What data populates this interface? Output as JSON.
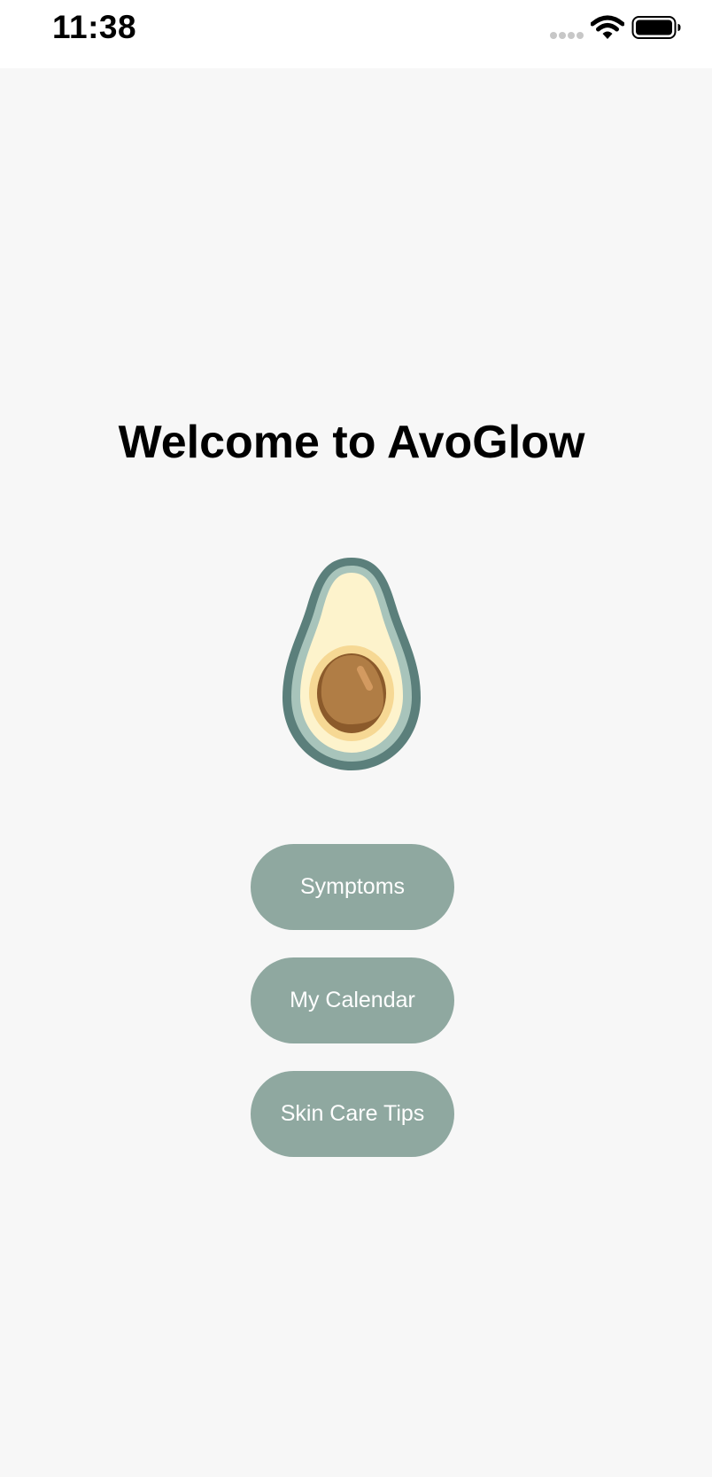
{
  "status_bar": {
    "time": "11:38"
  },
  "main": {
    "title": "Welcome to AvoGlow",
    "buttons": {
      "symptoms": "Symptoms",
      "calendar": "My Calendar",
      "tips": "Skin Care Tips"
    },
    "button_color": "#8fa8a0",
    "background_color": "#f7f7f7"
  },
  "icons": {
    "logo": "avocado-icon",
    "wifi": "wifi-icon",
    "battery": "battery-icon",
    "signal": "signal-dots-icon"
  }
}
